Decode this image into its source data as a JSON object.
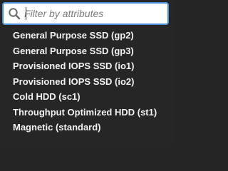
{
  "filter": {
    "placeholder": "Filter by attributes",
    "value": ""
  },
  "options": [
    {
      "label": "General Purpose SSD (gp2)"
    },
    {
      "label": "General Purpose SSD (gp3)"
    },
    {
      "label": "Provisioned IOPS SSD (io1)"
    },
    {
      "label": "Provisioned IOPS SSD (io2)"
    },
    {
      "label": "Cold HDD (sc1)"
    },
    {
      "label": "Throughput Optimized HDD (st1)"
    },
    {
      "label": "Magnetic (standard)"
    }
  ],
  "icons": {
    "search": "search-icon"
  },
  "colors": {
    "background": "#262626",
    "focus_border": "#4a90d9",
    "option_text": "#f2f2f2"
  }
}
